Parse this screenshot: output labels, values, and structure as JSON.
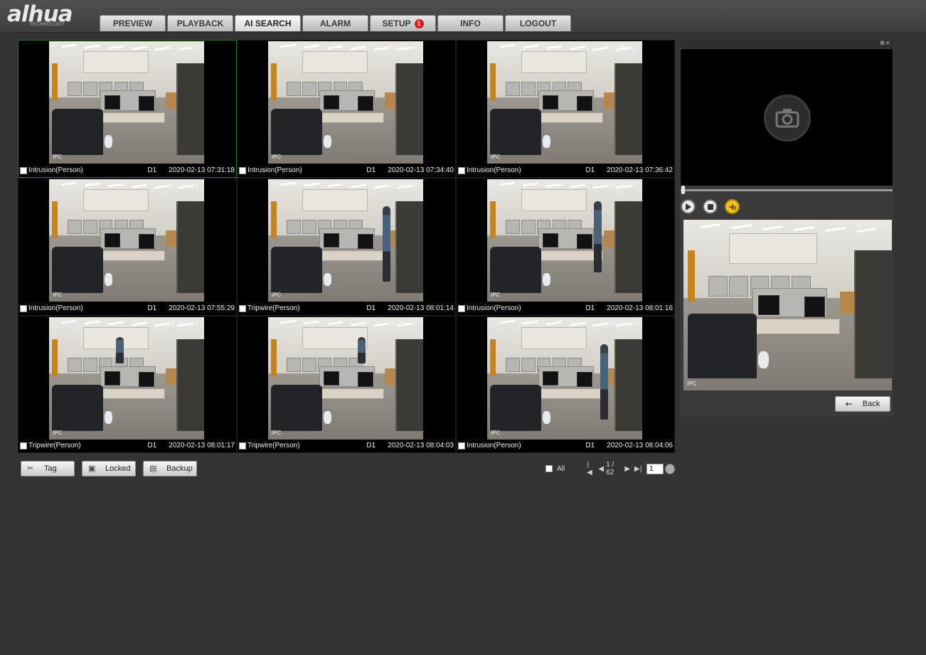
{
  "logo": {
    "brand": "alhua",
    "sub": "TECHNOLOGY"
  },
  "tabs": [
    {
      "label": "PREVIEW"
    },
    {
      "label": "PLAYBACK"
    },
    {
      "label": "AI SEARCH",
      "active": true
    },
    {
      "label": "ALARM"
    },
    {
      "label": "SETUP",
      "badge": "1"
    },
    {
      "label": "INFO"
    },
    {
      "label": "LOGOUT"
    }
  ],
  "results": [
    {
      "type": "Intrusion(Person)",
      "channel": "D1",
      "time": "2020-02-13 07:31:18"
    },
    {
      "type": "Intrusion(Person)",
      "channel": "D1",
      "time": "2020-02-13 07:34:40"
    },
    {
      "type": "Intrusion(Person)",
      "channel": "D1",
      "time": "2020-02-13 07:36:42"
    },
    {
      "type": "Intrusion(Person)",
      "channel": "D1",
      "time": "2020-02-13 07:55:29"
    },
    {
      "type": "Tripwire(Person)",
      "channel": "D1",
      "time": "2020-02-13 08:01:14"
    },
    {
      "type": "Intrusion(Person)",
      "channel": "D1",
      "time": "2020-02-13 08:01:16"
    },
    {
      "type": "Tripwire(Person)",
      "channel": "D1",
      "time": "2020-02-13 08:01:17"
    },
    {
      "type": "Tripwire(Person)",
      "channel": "D1",
      "time": "2020-02-13 08:04:03"
    },
    {
      "type": "Intrusion(Person)",
      "channel": "D1",
      "time": "2020-02-13 08:04:06"
    }
  ],
  "thumb_overlay": {
    "ipc": "IPC"
  },
  "actions": {
    "tag": "Tag",
    "locked": "Locked",
    "backup": "Backup"
  },
  "pager": {
    "all_label": "All",
    "page_text": "1 / 62",
    "page_input": "1"
  },
  "preview": {
    "timestamp": "2020-02-13 08:01:17"
  },
  "back_label": "Back",
  "icons": [
    "camera-off-icon",
    "play-icon",
    "stop-icon",
    "clip-icon",
    "zoom-icon",
    "close-icon",
    "tag-icon",
    "lock-icon",
    "backup-icon",
    "back-arrow-icon"
  ]
}
